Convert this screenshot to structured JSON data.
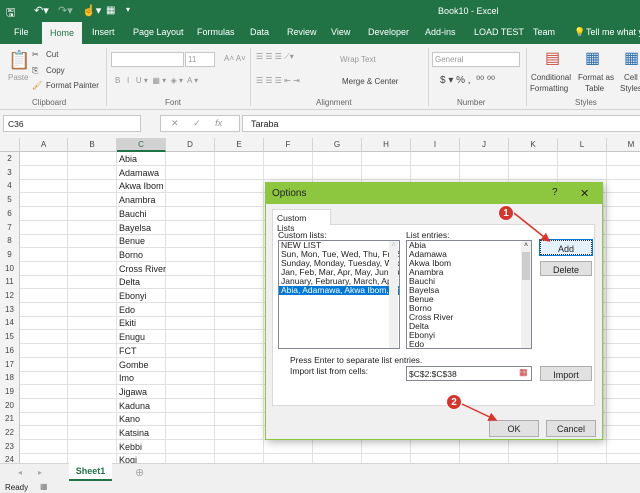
{
  "title": "Book10 - Excel",
  "tabs": [
    "File",
    "Home",
    "Insert",
    "Page Layout",
    "Formulas",
    "Data",
    "Review",
    "View",
    "Developer",
    "Add-ins",
    "LOAD TEST",
    "Team"
  ],
  "tell_me": "Tell me what you",
  "ribbon": {
    "paste": "Paste",
    "cut": "Cut",
    "copy": "Copy",
    "format_painter": "Format Painter",
    "clipboard": "Clipboard",
    "font_size": "11",
    "font": "Font",
    "wrap_text": "Wrap Text",
    "merge_center": "Merge & Center",
    "alignment": "Alignment",
    "number_format": "General",
    "number": "Number",
    "conditional": "Conditional",
    "formatting": "Formatting",
    "format_as": "Format as",
    "table": "Table",
    "cell": "Cell",
    "styles_btn": "Styles",
    "styles": "Styles"
  },
  "formula_bar": {
    "name_box": "C36",
    "fx": "fx",
    "value": "Taraba"
  },
  "columns": [
    "A",
    "B",
    "C",
    "D",
    "E",
    "F",
    "G",
    "H",
    "I",
    "J",
    "K",
    "L",
    "M"
  ],
  "rows": [
    {
      "n": "2",
      "c": "Abia"
    },
    {
      "n": "3",
      "c": "Adamawa"
    },
    {
      "n": "4",
      "c": "Akwa Ibom"
    },
    {
      "n": "5",
      "c": "Anambra"
    },
    {
      "n": "6",
      "c": "Bauchi"
    },
    {
      "n": "7",
      "c": "Bayelsa"
    },
    {
      "n": "8",
      "c": "Benue"
    },
    {
      "n": "9",
      "c": "Borno"
    },
    {
      "n": "10",
      "c": "Cross River"
    },
    {
      "n": "11",
      "c": "Delta"
    },
    {
      "n": "12",
      "c": "Ebonyi"
    },
    {
      "n": "13",
      "c": "Edo"
    },
    {
      "n": "14",
      "c": "Ekiti"
    },
    {
      "n": "15",
      "c": "Enugu"
    },
    {
      "n": "16",
      "c": "FCT"
    },
    {
      "n": "17",
      "c": "Gombe"
    },
    {
      "n": "18",
      "c": "Imo"
    },
    {
      "n": "19",
      "c": "Jigawa"
    },
    {
      "n": "20",
      "c": "Kaduna"
    },
    {
      "n": "21",
      "c": "Kano"
    },
    {
      "n": "22",
      "c": "Katsina"
    },
    {
      "n": "23",
      "c": "Kebbi"
    },
    {
      "n": "24",
      "c": "Kogi"
    }
  ],
  "sheet_tab": "Sheet1",
  "status": "Ready",
  "dialog": {
    "title": "Options",
    "help": "?",
    "close": "✕",
    "tab": "Custom Lists",
    "custom_lists_label": "Custom lists:",
    "custom_lists": [
      "NEW LIST",
      "Sun, Mon, Tue, Wed, Thu, Fri, Sat",
      "Sunday, Monday, Tuesday, Wednesday",
      "Jan, Feb, Mar, Apr, May, Jun, Jul",
      "January, February, March, April",
      "Abia, Adamawa, Akwa Ibom, Anambra"
    ],
    "list_entries_label": "List entries:",
    "list_entries": [
      "Abia",
      "Adamawa",
      "Akwa Ibom",
      "Anambra",
      "Bauchi",
      "Bayelsa",
      "Benue",
      "Borno",
      "Cross River",
      "Delta",
      "Ebonyi",
      "Edo"
    ],
    "add": "Add",
    "delete": "Delete",
    "hint": "Press Enter to separate list entries.",
    "import_label": "Import list from cells:",
    "import_range": "$C$2:$C$38",
    "import": "Import",
    "ok": "OK",
    "cancel": "Cancel"
  },
  "annotations": [
    "1",
    "2"
  ],
  "colors": {
    "excel_green": "#217346",
    "dialog_green": "#8dc63f",
    "badge": "#d9342b"
  }
}
